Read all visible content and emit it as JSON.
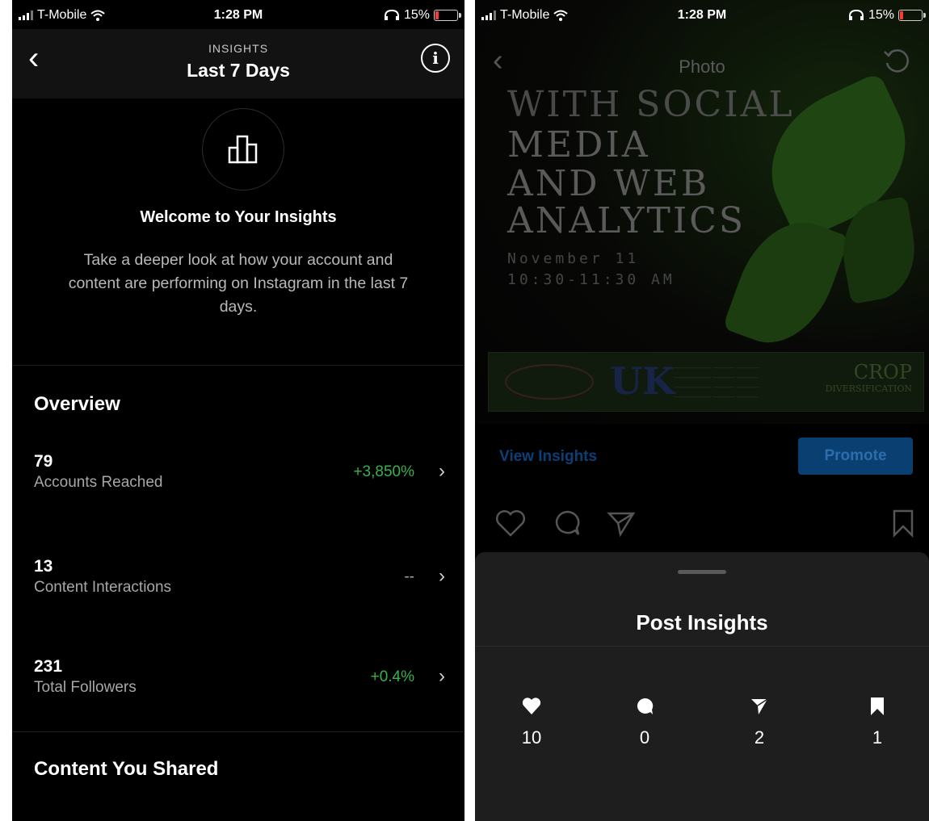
{
  "left": {
    "status": {
      "carrier": "T-Mobile",
      "time": "1:28 PM",
      "battery": "15%"
    },
    "header": {
      "subtitle": "INSIGHTS",
      "title": "Last 7 Days"
    },
    "welcome": {
      "title": "Welcome to Your Insights",
      "body": "Take a deeper look at how your account and content are performing on Instagram in the last 7 days."
    },
    "overview": {
      "title": "Overview",
      "items": [
        {
          "value": "79",
          "label": "Accounts Reached",
          "change": "+3,850%"
        },
        {
          "value": "13",
          "label": "Content Interactions",
          "change": "--"
        },
        {
          "value": "231",
          "label": "Total Followers",
          "change": "+0.4%"
        }
      ]
    },
    "content_shared": "Content You Shared"
  },
  "right": {
    "status": {
      "carrier": "T-Mobile",
      "time": "1:28 PM",
      "battery": "15%"
    },
    "header": {
      "title": "Photo"
    },
    "photo": {
      "lines": [
        "WITH SOCIAL",
        "MEDIA",
        "AND WEB",
        "ANALYTICS"
      ],
      "date": "November 11",
      "time": "10:30-11:30 AM",
      "logo_uk": "UK",
      "logo_crop": "CROP",
      "logo_crop_sub": "DIVERSIFICATION"
    },
    "view_insights": "View Insights",
    "promote": "Promote",
    "sheet": {
      "title": "Post Insights",
      "metrics": [
        {
          "icon": "heart-icon",
          "value": "10"
        },
        {
          "icon": "comment-icon",
          "value": "0"
        },
        {
          "icon": "share-icon",
          "value": "2"
        },
        {
          "icon": "bookmark-icon",
          "value": "1"
        }
      ]
    }
  },
  "colors": {
    "positive": "#37b24d",
    "background": "#000000",
    "sheet": "#1e1e1e",
    "accent": "#0a3f72"
  }
}
